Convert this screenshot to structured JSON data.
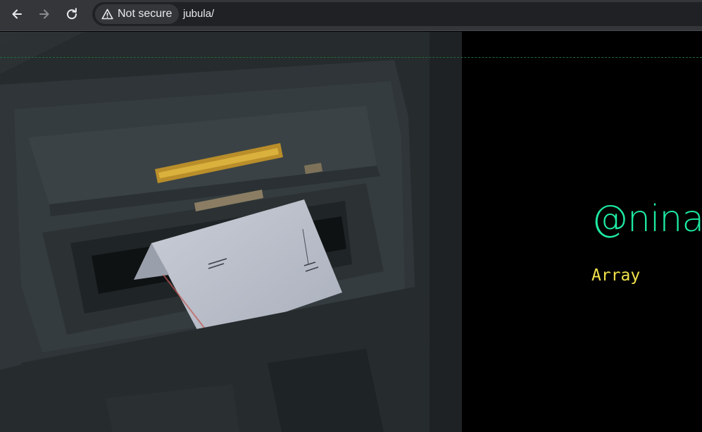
{
  "browser": {
    "back_icon": "arrow-left-icon",
    "forward_icon": "arrow-right-icon",
    "reload_icon": "reload-icon",
    "security_icon": "warning-triangle-icon",
    "security_label": "Not secure",
    "url": "jubula/"
  },
  "page": {
    "hero_image_icon": "mailbox-letter-photo",
    "handle": "@nina",
    "subtitle": "Array",
    "colors": {
      "background": "#000000",
      "handle": "#1de9a0",
      "subtitle": "#f2e34a",
      "divider": "#1f6a3c"
    }
  }
}
